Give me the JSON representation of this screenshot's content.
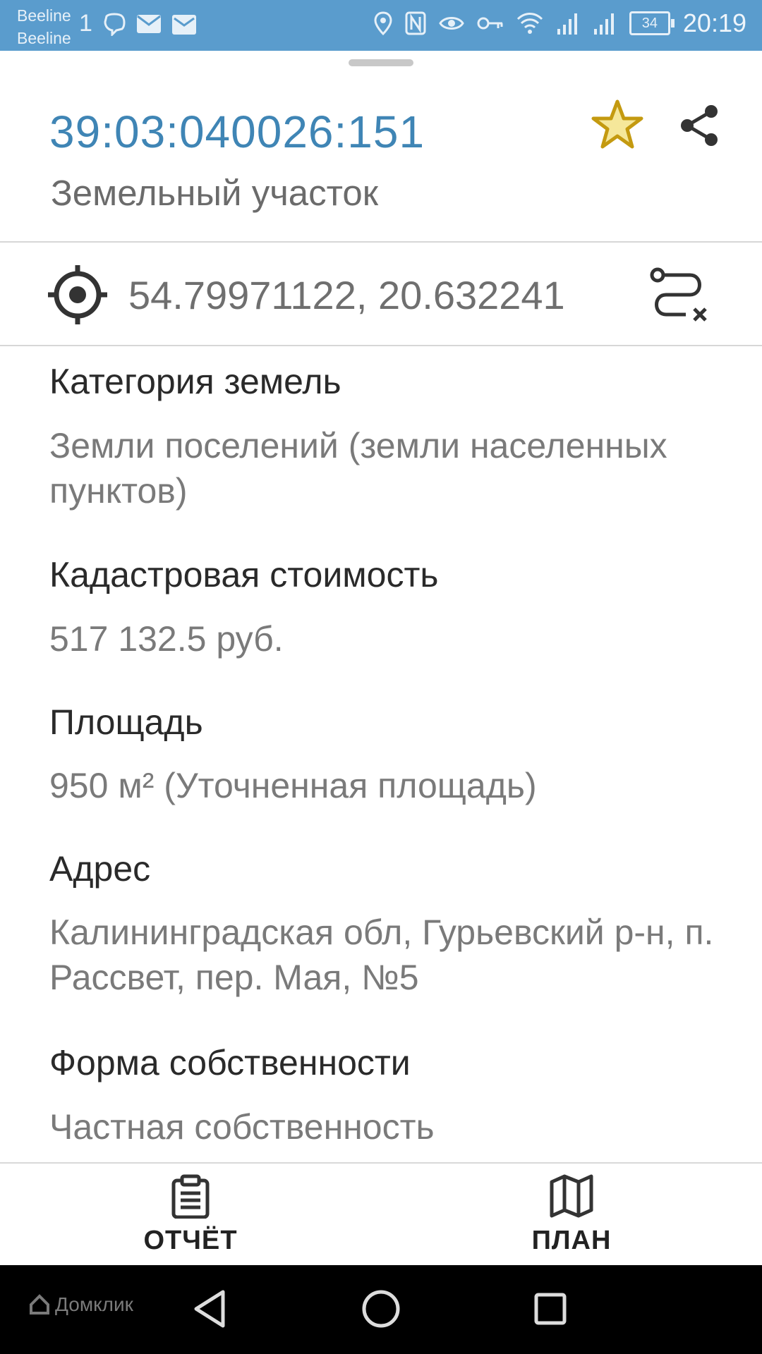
{
  "status_bar": {
    "carrier1": "Beeline",
    "carrier2": "Beeline",
    "sim_indicator": "1",
    "battery": "34",
    "time": "20:19",
    "icons": [
      "viber-icon",
      "mail-icon",
      "mail-icon",
      "location-icon",
      "nfc-icon",
      "eye-icon",
      "key-icon",
      "wifi-icon",
      "signal-icon",
      "signal-icon",
      "battery-icon"
    ]
  },
  "header": {
    "cadastral_number": "39:03:040026:151",
    "object_type": "Земельный участок"
  },
  "coordinates": "54.79971122, 20.632241",
  "fields": [
    {
      "label": "Категория земель",
      "value": "Земли поселений (земли населенных пунктов)"
    },
    {
      "label": "Кадастровая стоимость",
      "value": "517 132.5 руб."
    },
    {
      "label": "Площадь",
      "value": "950 м² (Уточненная площадь)"
    },
    {
      "label": "Адрес",
      "value": "Калининградская обл, Гурьевский р-н, п. Рассвет, пер. Мая, №5"
    },
    {
      "label": "Форма собственности",
      "value": "Частная собственность"
    }
  ],
  "actions": {
    "report_label": "ОТЧЁТ",
    "plan_label": "ПЛАН"
  },
  "navbar": {
    "brand": "Домклик"
  },
  "colors": {
    "status_bar": "#5a9ccd",
    "accent": "#3f85b5",
    "star_fill": "#f5e79a",
    "star_stroke": "#c49a10"
  }
}
